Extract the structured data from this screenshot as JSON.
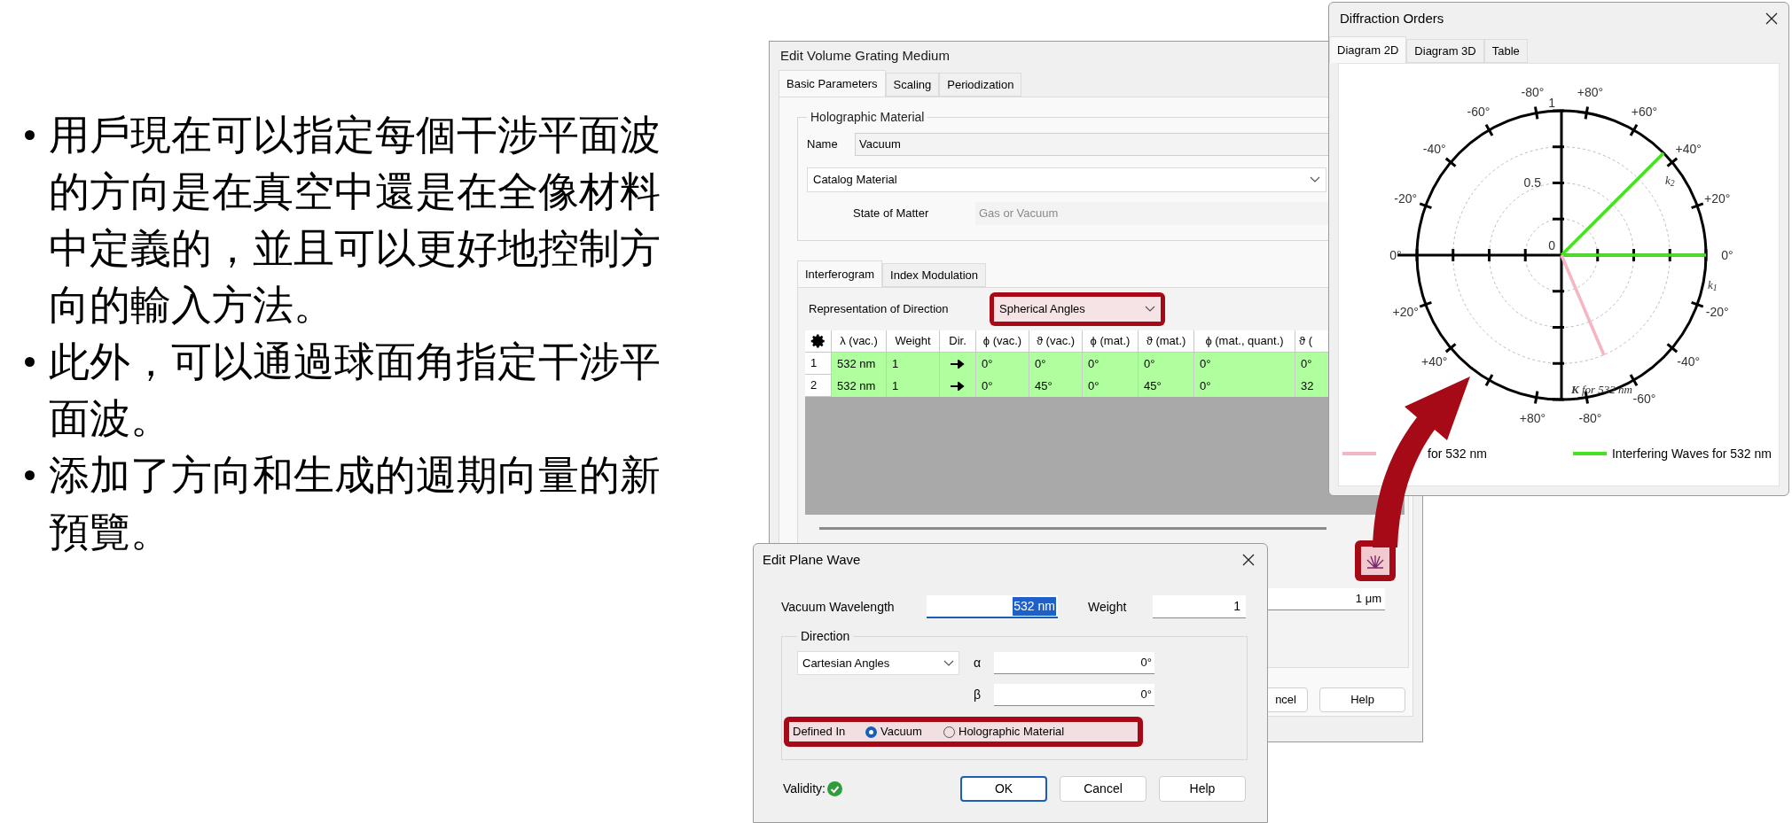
{
  "bullets": [
    "用戶現在可以指定每個干涉平面波的方向是在真空中還是在全像材料中定義的，並且可以更好地控制方向的輸入方法。",
    "此外，可以通過球面角指定干涉平面波。",
    "添加了方向和生成的週期向量的新預覽。"
  ],
  "grating_dialog": {
    "title": "Edit Volume Grating Medium",
    "tabs": [
      {
        "label": "Basic Parameters",
        "selected": true
      },
      {
        "label": "Scaling",
        "selected": false
      },
      {
        "label": "Periodization",
        "selected": false
      }
    ],
    "group_title": "Holographic Material",
    "name_label": "Name",
    "name_value": "Vacuum",
    "material_source": "Catalog Material",
    "state_label": "State of Matter",
    "state_value": "Gas or Vacuum",
    "inner_tabs": [
      {
        "label": "Interferogram",
        "selected": true
      },
      {
        "label": "Index Modulation",
        "selected": false
      }
    ],
    "direction_label": "Representation of Direction",
    "direction_value": "Spherical Angles",
    "direction_highlighted": true,
    "columns": [
      {
        "kind": "settings"
      },
      {
        "kind": "text",
        "label": "λ (vac.)"
      },
      {
        "kind": "text",
        "label": "Weight"
      },
      {
        "kind": "text",
        "label": "Dir."
      },
      {
        "kind": "text",
        "label": "ϕ (vac.)"
      },
      {
        "kind": "text",
        "label": "ϑ (vac.)"
      },
      {
        "kind": "text",
        "label": "ϕ (mat.)"
      },
      {
        "kind": "text",
        "label": "ϑ (mat.)"
      },
      {
        "kind": "text",
        "label": "ϕ (mat., quant.)"
      },
      {
        "kind": "text",
        "label": "ϑ ("
      }
    ],
    "rows": [
      {
        "valid": true,
        "cells": [
          "1",
          "532 nm",
          "1",
          "",
          "0°",
          "0°",
          "0°",
          "0°",
          "0°",
          "0°"
        ]
      },
      {
        "valid": true,
        "cells": [
          "2",
          "532 nm",
          "1",
          "",
          "0°",
          "45°",
          "0°",
          "45°",
          "0°",
          "32"
        ]
      }
    ],
    "preview_highlighted": true,
    "period_value": "1 μm",
    "cancel_label": "ncel",
    "help_label": "Help"
  },
  "plane_wave_dialog": {
    "title": "Edit Plane Wave",
    "wavelength_label": "Vacuum Wavelength",
    "wavelength_value": "532 nm",
    "weight_label": "Weight",
    "weight_value": "1",
    "direction_title": "Direction",
    "angle_type": "Cartesian Angles",
    "alpha_label": "α",
    "alpha_value": "0°",
    "beta_label": "β",
    "beta_value": "0°",
    "defined_in_label": "Defined In",
    "defined_in_highlighted": true,
    "defined_in": [
      {
        "label": "Vacuum",
        "selected": true
      },
      {
        "label": "Holographic Material",
        "selected": false
      }
    ],
    "validity_label": "Validity:",
    "valid": true,
    "buttons": [
      {
        "label": "OK",
        "focused": true
      },
      {
        "label": "Cancel",
        "focused": false
      },
      {
        "label": "Help",
        "focused": false
      }
    ]
  },
  "diffraction_window": {
    "title": "Diffraction Orders",
    "tabs": [
      {
        "label": "Diagram 2D",
        "selected": true
      },
      {
        "label": "Diagram 3D",
        "selected": false
      },
      {
        "label": "Table",
        "selected": false
      }
    ],
    "upper_right": [
      "0°",
      "+20°",
      "+40°",
      "+60°",
      "+80°"
    ],
    "upper_left": [
      "0°",
      "-20°",
      "-40°",
      "-60°",
      "-80°"
    ],
    "lower_right": [
      "-20°",
      "-40°",
      "-60°",
      "-80°"
    ],
    "lower_left": [
      "+20°",
      "+40°",
      "+80°"
    ],
    "radial_labels": [
      "1",
      "0.5",
      "0"
    ],
    "vectors": [
      {
        "label": "k$_{1}$",
        "color": "#44e21f"
      },
      {
        "label": "k$_{2}$",
        "color": "#44e21f"
      },
      {
        "label": "**K** for 532 nm",
        "color": "#f4b6c2"
      }
    ],
    "legend": [
      {
        "label": "for 532 nm",
        "color": "#f4b6c2"
      },
      {
        "label": "Interfering Waves for 532 nm",
        "color": "#44e21f"
      }
    ]
  }
}
